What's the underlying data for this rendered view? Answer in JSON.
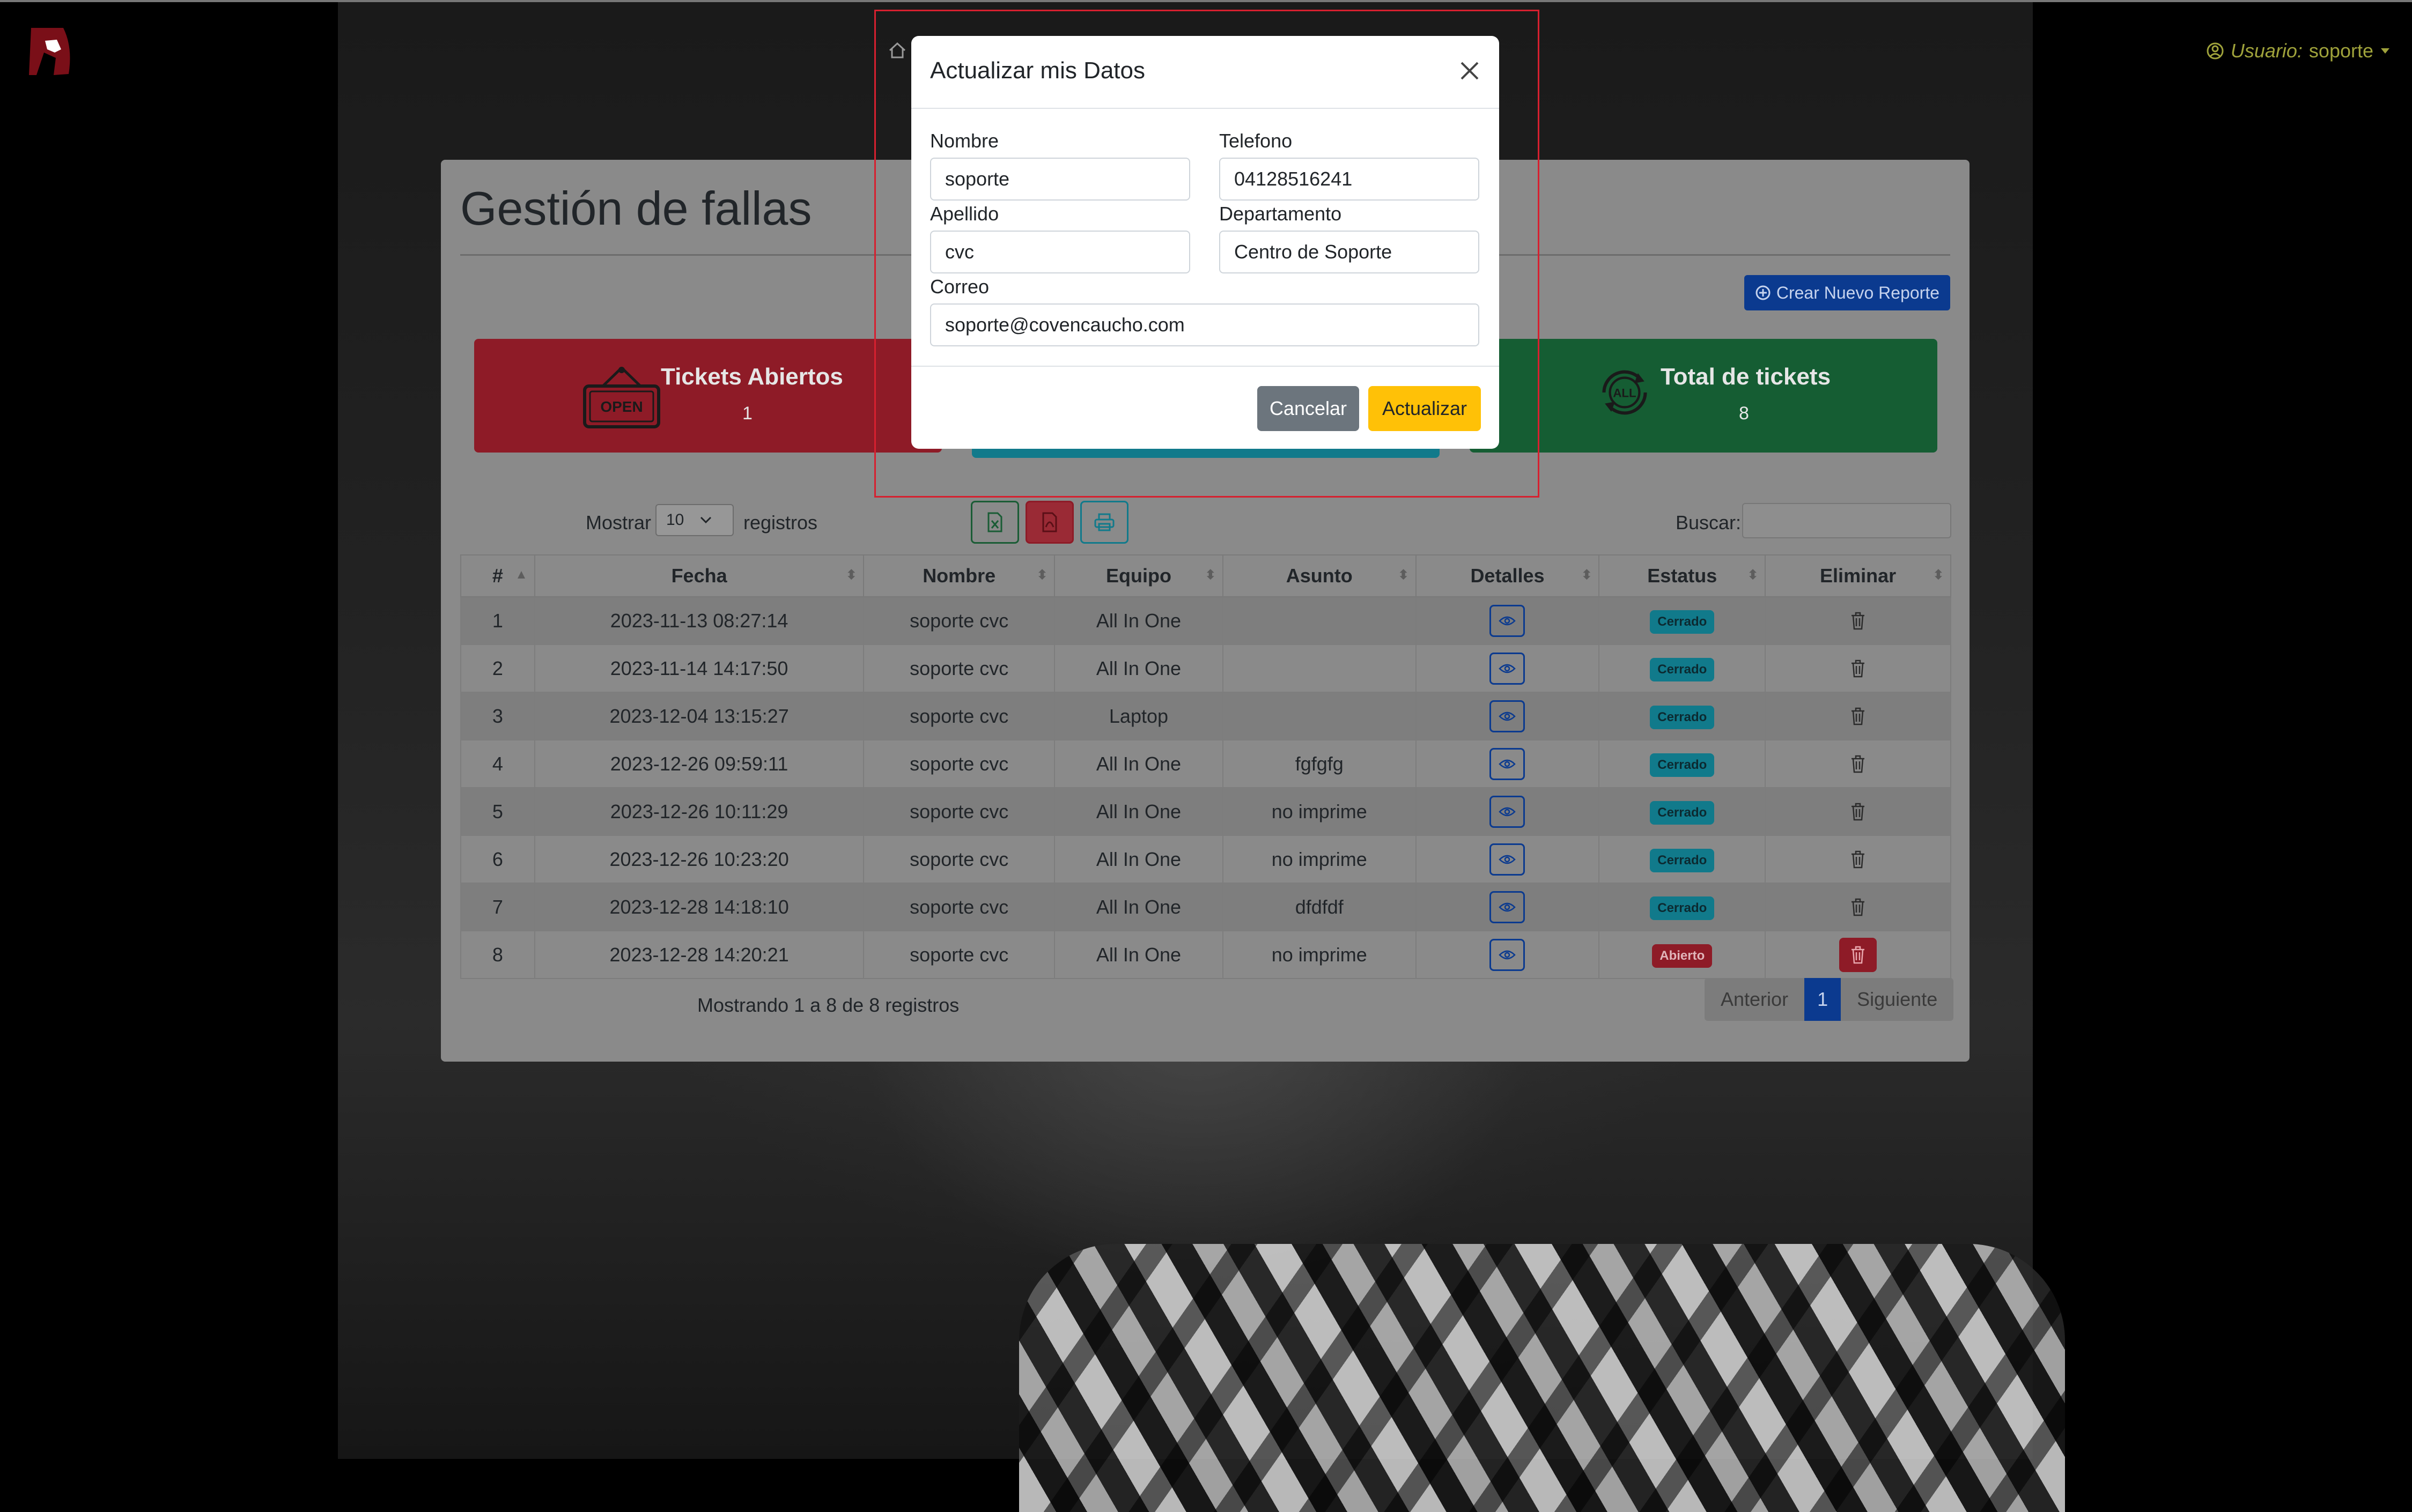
{
  "header": {
    "user_prefix": "Usuario:",
    "user_name": "soporte"
  },
  "page": {
    "title": "Gestión de fallas",
    "new_report_label": "Crear Nuevo Reporte"
  },
  "cards": {
    "open": {
      "label": "Tickets Abiertos",
      "count": "1",
      "sign_text": "OPEN"
    },
    "total": {
      "label": "Total de tickets",
      "count": "8",
      "icon_text": "ALL"
    }
  },
  "table_controls": {
    "show_label": "Mostrar",
    "show_value": "10",
    "records_label": "registros",
    "search_label": "Buscar:"
  },
  "table": {
    "columns": [
      "#",
      "Fecha",
      "Nombre",
      "Equipo",
      "Asunto",
      "Detalles",
      "Estatus",
      "Eliminar"
    ],
    "rows": [
      {
        "n": "1",
        "fecha": "2023-11-13 08:27:14",
        "nombre": "soporte cvc",
        "equipo": "All In One",
        "asunto": "",
        "estatus": "Cerrado"
      },
      {
        "n": "2",
        "fecha": "2023-11-14 14:17:50",
        "nombre": "soporte cvc",
        "equipo": "All In One",
        "asunto": "",
        "estatus": "Cerrado"
      },
      {
        "n": "3",
        "fecha": "2023-12-04 13:15:27",
        "nombre": "soporte cvc",
        "equipo": "Laptop",
        "asunto": "",
        "estatus": "Cerrado"
      },
      {
        "n": "4",
        "fecha": "2023-12-26 09:59:11",
        "nombre": "soporte cvc",
        "equipo": "All In One",
        "asunto": "fgfgfg",
        "estatus": "Cerrado"
      },
      {
        "n": "5",
        "fecha": "2023-12-26 10:11:29",
        "nombre": "soporte cvc",
        "equipo": "All In One",
        "asunto": "no imprime",
        "estatus": "Cerrado"
      },
      {
        "n": "6",
        "fecha": "2023-12-26 10:23:20",
        "nombre": "soporte cvc",
        "equipo": "All In One",
        "asunto": "no imprime",
        "estatus": "Cerrado"
      },
      {
        "n": "7",
        "fecha": "2023-12-28 14:18:10",
        "nombre": "soporte cvc",
        "equipo": "All In One",
        "asunto": "dfdfdf",
        "estatus": "Cerrado"
      },
      {
        "n": "8",
        "fecha": "2023-12-28 14:20:21",
        "nombre": "soporte cvc",
        "equipo": "All In One",
        "asunto": "no imprime",
        "estatus": "Abierto"
      }
    ]
  },
  "pagination": {
    "info": "Mostrando 1 a 8 de 8 registros",
    "prev": "Anterior",
    "current": "1",
    "next": "Siguiente"
  },
  "modal": {
    "title": "Actualizar mis Datos",
    "fields": {
      "nombre": {
        "label": "Nombre",
        "value": "soporte"
      },
      "telefono": {
        "label": "Telefono",
        "value": "04128516241"
      },
      "apellido": {
        "label": "Apellido",
        "value": "cvc"
      },
      "departamento": {
        "label": "Departamento",
        "value": "Centro de Soporte"
      },
      "correo": {
        "label": "Correo",
        "value": "soporte@covencaucho.com"
      }
    },
    "cancel_label": "Cancelar",
    "update_label": "Actualizar"
  },
  "colors": {
    "danger": "#dc3545",
    "info": "#0dcaf0",
    "success": "#198754",
    "primary": "#0d6efd",
    "warning": "#ffc107",
    "secondary": "#6c757d"
  },
  "icons": [
    "logo",
    "user-circle-icon",
    "caret-down-icon",
    "home-icon",
    "plus-circle-icon",
    "open-sign-icon",
    "all-cycle-icon",
    "excel-icon",
    "pdf-icon",
    "print-icon",
    "eye-icon",
    "trash-icon",
    "close-icon",
    "sort-icon"
  ]
}
